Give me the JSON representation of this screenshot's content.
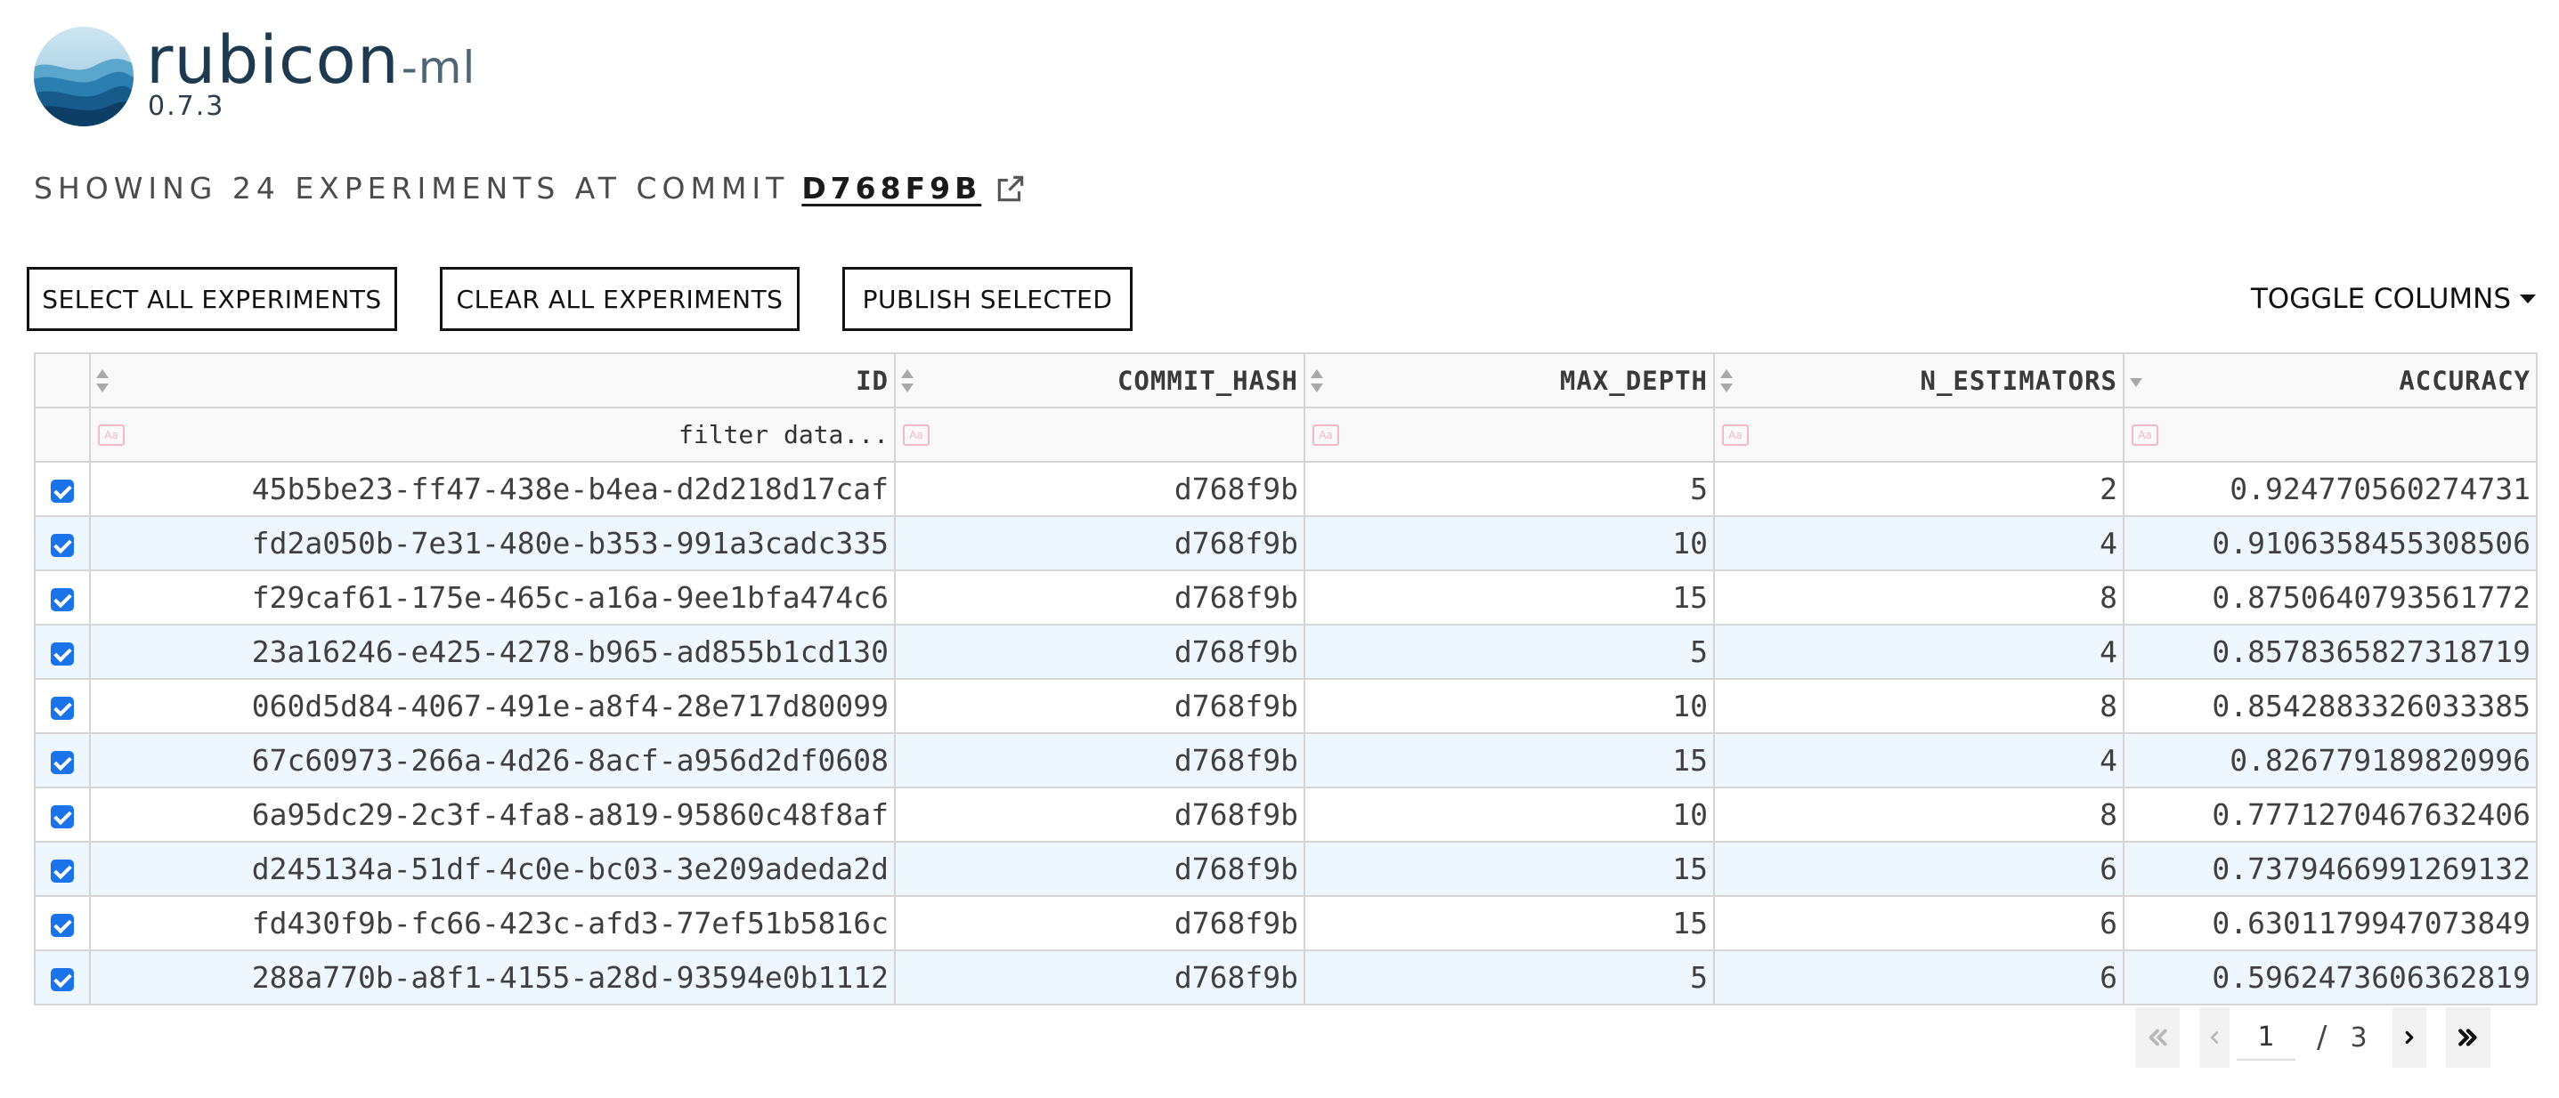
{
  "app": {
    "logo_text": "rubicon",
    "logo_suffix": "-ml",
    "version": "0.7.3"
  },
  "headline": {
    "prefix": "SHOWING 24 EXPERIMENTS AT COMMIT",
    "commit": "D768F9B",
    "link_icon": "external-link-icon"
  },
  "toolbar": {
    "select_all": "SELECT ALL EXPERIMENTS",
    "clear_all": "CLEAR ALL EXPERIMENTS",
    "publish": "PUBLISH SELECTED",
    "toggle_columns": "TOGGLE COLUMNS"
  },
  "table": {
    "columns": [
      "ID",
      "COMMIT_HASH",
      "MAX_DEPTH",
      "N_ESTIMATORS",
      "ACCURACY"
    ],
    "filter_placeholder": "filter data...",
    "sorted_column": "ACCURACY",
    "sort_direction": "descending",
    "rows": [
      {
        "checked": true,
        "id": "45b5be23-ff47-438e-b4ea-d2d218d17caf",
        "commit_hash": "d768f9b",
        "max_depth": "5",
        "n_estimators": "2",
        "accuracy": "0.924770560274731"
      },
      {
        "checked": true,
        "id": "fd2a050b-7e31-480e-b353-991a3cadc335",
        "commit_hash": "d768f9b",
        "max_depth": "10",
        "n_estimators": "4",
        "accuracy": "0.9106358455308506"
      },
      {
        "checked": true,
        "id": "f29caf61-175e-465c-a16a-9ee1bfa474c6",
        "commit_hash": "d768f9b",
        "max_depth": "15",
        "n_estimators": "8",
        "accuracy": "0.8750640793561772"
      },
      {
        "checked": true,
        "id": "23a16246-e425-4278-b965-ad855b1cd130",
        "commit_hash": "d768f9b",
        "max_depth": "5",
        "n_estimators": "4",
        "accuracy": "0.8578365827318719"
      },
      {
        "checked": true,
        "id": "060d5d84-4067-491e-a8f4-28e717d80099",
        "commit_hash": "d768f9b",
        "max_depth": "10",
        "n_estimators": "8",
        "accuracy": "0.8542883326033385"
      },
      {
        "checked": true,
        "id": "67c60973-266a-4d26-8acf-a956d2df0608",
        "commit_hash": "d768f9b",
        "max_depth": "15",
        "n_estimators": "4",
        "accuracy": "0.826779189820996"
      },
      {
        "checked": true,
        "id": "6a95dc29-2c3f-4fa8-a819-95860c48f8af",
        "commit_hash": "d768f9b",
        "max_depth": "10",
        "n_estimators": "8",
        "accuracy": "0.7771270467632406"
      },
      {
        "checked": true,
        "id": "d245134a-51df-4c0e-bc03-3e209adeda2d",
        "commit_hash": "d768f9b",
        "max_depth": "15",
        "n_estimators": "6",
        "accuracy": "0.7379466991269132"
      },
      {
        "checked": true,
        "id": "fd430f9b-fc66-423c-afd3-77ef51b5816c",
        "commit_hash": "d768f9b",
        "max_depth": "15",
        "n_estimators": "6",
        "accuracy": "0.6301179947073849"
      },
      {
        "checked": true,
        "id": "288a770b-a8f1-4155-a28d-93594e0b1112",
        "commit_hash": "d768f9b",
        "max_depth": "5",
        "n_estimators": "6",
        "accuracy": "0.5962473606362819"
      }
    ]
  },
  "pagination": {
    "current_page": "1",
    "separator": "/",
    "total_pages": "3",
    "first_icon": "double-chevron-left-icon",
    "prev_icon": "chevron-left-icon",
    "next_icon": "chevron-right-icon",
    "last_icon": "double-chevron-right-icon"
  },
  "colors": {
    "logo_dark": "#1d3a50",
    "checkbox_blue": "#1a73e8",
    "row_stripe": "#eef7fd",
    "filter_icon_pink": "#f2b8c6"
  }
}
